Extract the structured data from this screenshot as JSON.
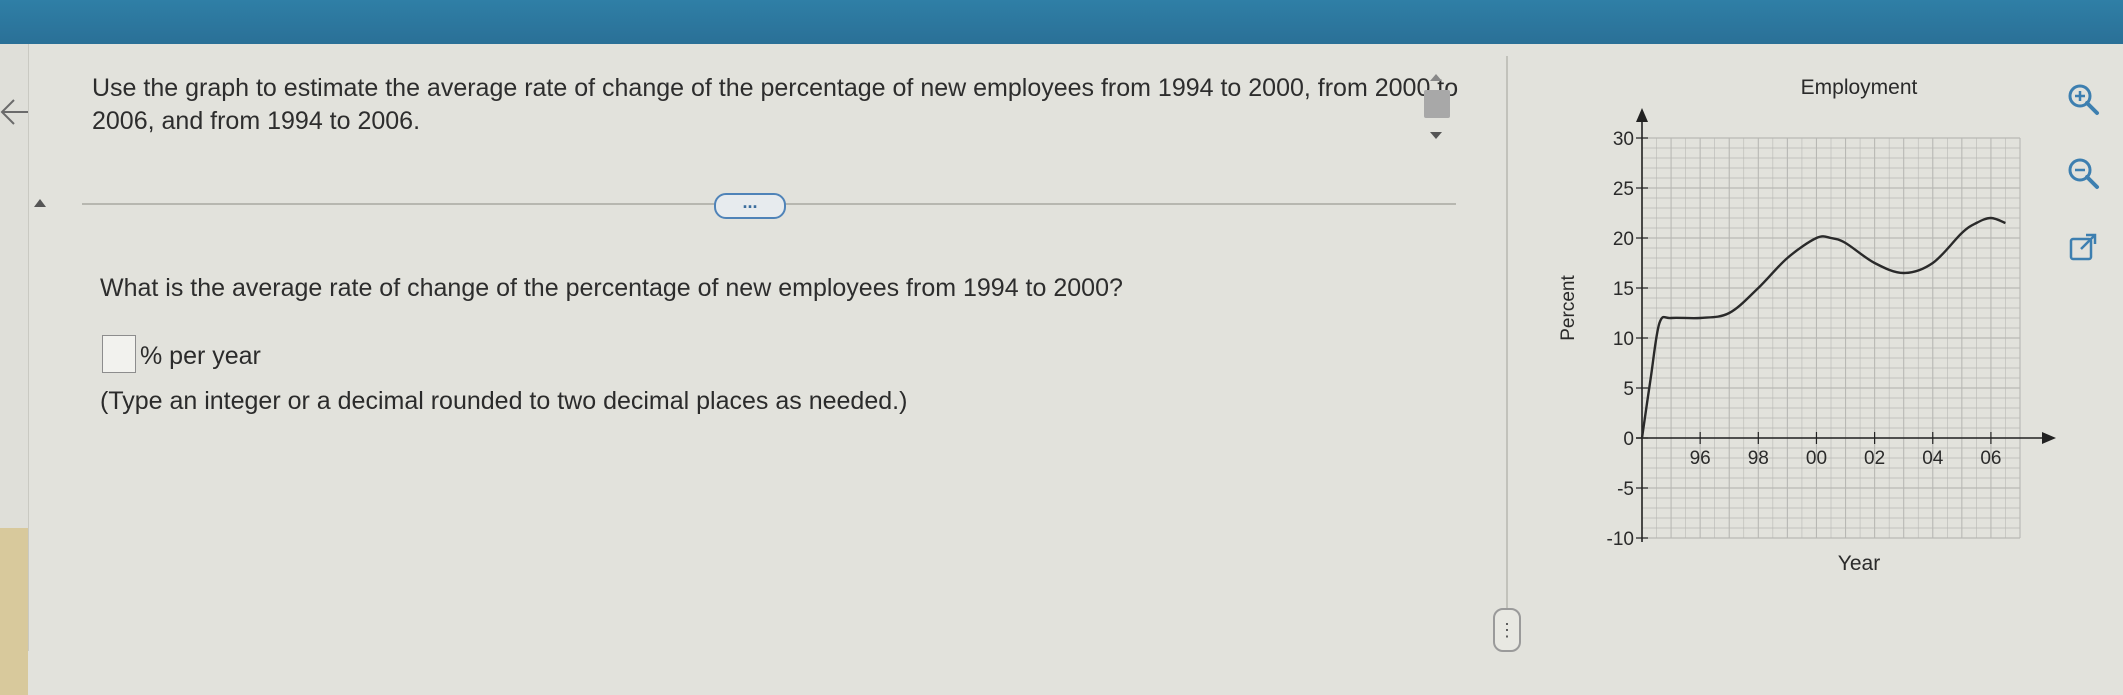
{
  "question": {
    "prompt": "Use the graph to estimate the average rate of change of the percentage of new employees from 1994 to 2000, from 2000 to 2006, and from 1994 to 2006.",
    "sub_question": "What is the average rate of change of the percentage of new employees from 1994 to 2000?",
    "answer_value": "",
    "answer_unit": "% per year",
    "hint": "(Type an integer or a decimal rounded to two decimal places as needed.)",
    "more_label": "..."
  },
  "colors": {
    "topbar": "#2a7097",
    "accent_button": "#4f83b8",
    "curve": "#2a2a2a"
  },
  "icons": {
    "back": "arrow-left-icon",
    "zoom_in": "zoom-in-icon",
    "zoom_out": "zoom-out-icon",
    "popout": "external-link-icon"
  },
  "chart_data": {
    "type": "line",
    "title": "Employment",
    "xlabel": "Year",
    "ylabel": "Percent",
    "x_ticks": [
      1996,
      1998,
      2000,
      2002,
      2004,
      2006
    ],
    "x_tick_labels": [
      "96",
      "98",
      "00",
      "02",
      "04",
      "06"
    ],
    "y_ticks": [
      -10,
      -5,
      0,
      5,
      10,
      15,
      20,
      25,
      30
    ],
    "y_tick_labels": [
      "-10",
      "-5",
      "0",
      "5",
      "10",
      "15",
      "20",
      "25",
      "30"
    ],
    "xlim": [
      1994,
      2007
    ],
    "ylim": [
      -10,
      30
    ],
    "grid": true,
    "series": [
      {
        "x": [
          1994,
          1994.3,
          1994.6,
          1995,
          1996,
          1997,
          1998,
          1999,
          2000,
          2000.5,
          2001,
          2002,
          2003,
          2004,
          2005,
          2005.5,
          2006,
          2006.5
        ],
        "y": [
          0,
          6,
          11.5,
          12,
          12,
          12.5,
          15,
          18,
          20,
          20,
          19.5,
          17.5,
          16.5,
          17.5,
          20.5,
          21.5,
          22,
          21.5
        ]
      }
    ]
  }
}
